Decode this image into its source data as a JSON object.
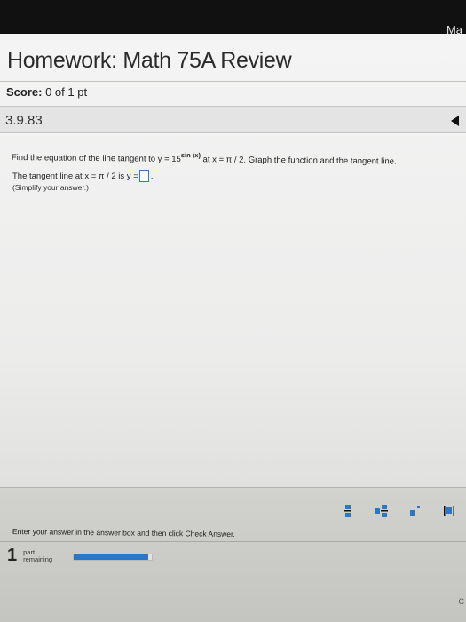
{
  "system": {
    "corner_text": "Ma"
  },
  "header": {
    "title": "Homework: Math 75A Review",
    "score_label": "Score:",
    "score_value": "0 of 1 pt"
  },
  "question_bar": {
    "number": "3.9.83",
    "nav_icon": "left-arrow-icon"
  },
  "question": {
    "prompt_before": "Find the equation of the line tangent to y = 15",
    "exponent": "sin (x)",
    "prompt_after": " at x = π / 2. Graph the function and the tangent line.",
    "answer_prefix": "The tangent line at x = π / 2 is y =",
    "answer_value": "",
    "answer_suffix": ".",
    "hint": "(Simplify your answer.)"
  },
  "footer": {
    "instructions": "Enter your answer in the answer box and then click Check Answer.",
    "tools": [
      "fraction-icon",
      "mixed-number-icon",
      "exponent-icon",
      "absolute-value-icon"
    ],
    "parts_remaining_count": "1",
    "parts_remaining_line1": "part",
    "parts_remaining_line2": "remaining",
    "progress_fraction": 0.95,
    "corner_text": "C"
  },
  "colors": {
    "accent": "#2e76c5",
    "answer_box_border": "#2f79c7"
  }
}
